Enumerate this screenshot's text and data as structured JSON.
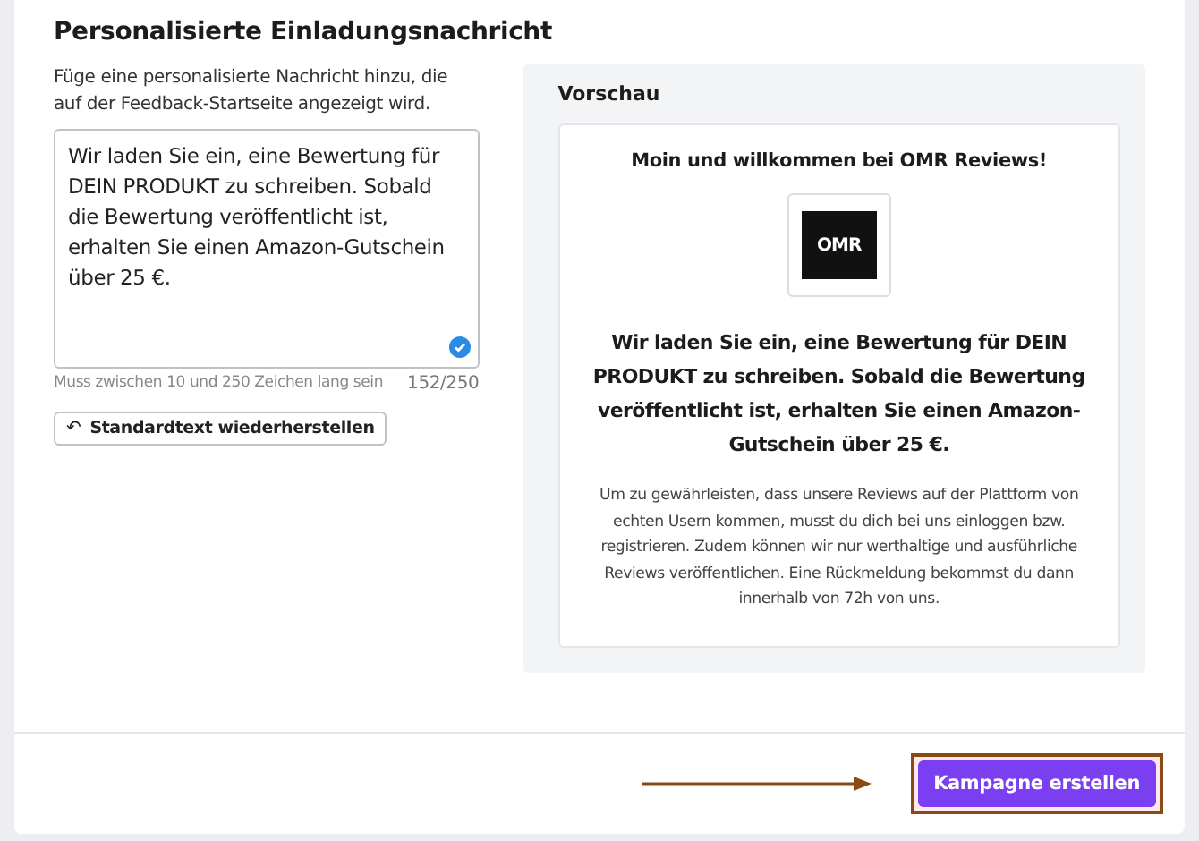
{
  "title": "Personalisierte Einladungsnachricht",
  "description": "Füge eine personalisierte Nachricht hinzu, die auf der Feedback-Startseite angezeigt wird.",
  "message_field": {
    "value": "Wir laden Sie ein, eine Bewertung für DEIN PRODUKT zu schreiben. Sobald die Bewertung veröffentlicht ist, erhalten Sie einen Amazon-Gutschein über 25 €.",
    "valid": true,
    "hint": "Muss zwischen 10 und 250 Zeichen lang sein",
    "counter": "152/250"
  },
  "reset_button": {
    "icon": "↶",
    "label": "Standardtext wiederherstellen"
  },
  "preview": {
    "heading": "Vorschau",
    "greeting": "Moin und willkommen bei OMR Reviews!",
    "logo_text": "OMR",
    "message": "Wir laden Sie ein, eine Bewertung für DEIN PRODUKT zu schreiben. Sobald die Bewertung veröffentlicht ist, erhalten Sie einen Amazon-Gutschein über 25 €.",
    "note": "Um zu gewährleisten, dass unsere Reviews auf der Plattform von echten Usern kommen, musst du dich bei uns einloggen bzw. registrieren. Zudem können wir nur werthaltige und ausführliche Reviews veröffentlichen. Eine Rückmeldung bekommst du dann innerhalb von 72h von uns."
  },
  "submit_button": {
    "label": "Kampagne erstellen",
    "highlighted": true
  }
}
